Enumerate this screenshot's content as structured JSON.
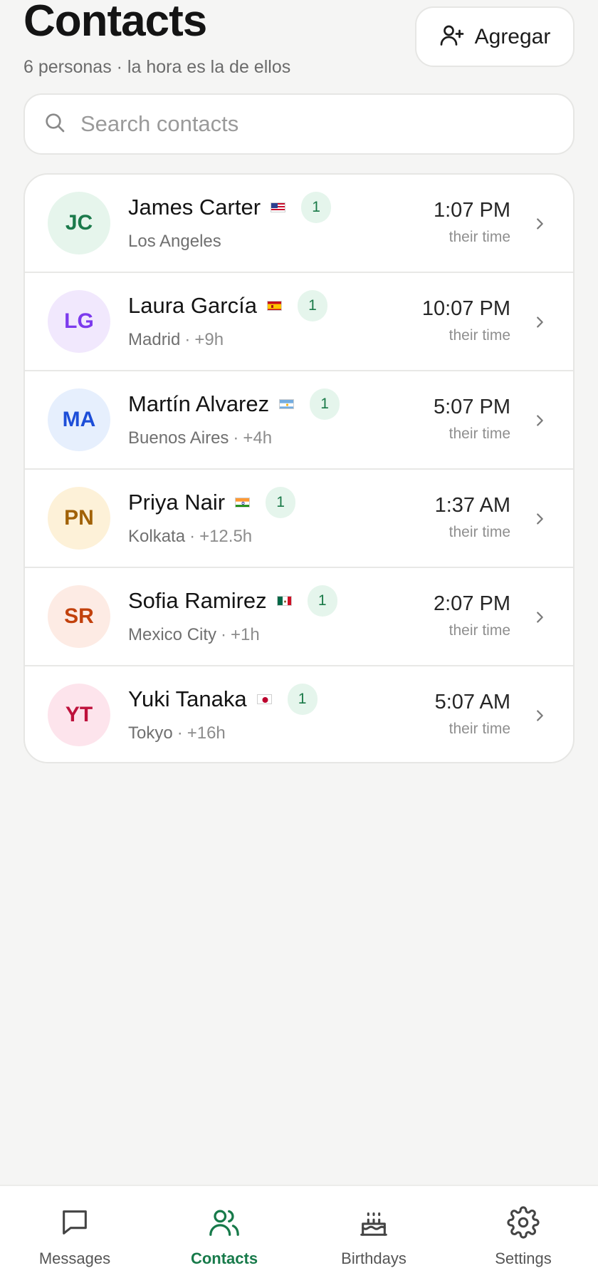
{
  "header": {
    "title": "Contacts",
    "subtitle": "6 personas · la hora es la de ellos",
    "add_label": "Agregar"
  },
  "search": {
    "placeholder": "Search contacts",
    "value": ""
  },
  "contacts": [
    {
      "initials": "JC",
      "name": "James Carter",
      "flag": "flag-us-icon",
      "badge": "1",
      "city": "Los Angeles",
      "offset": "",
      "time": "1:07 PM",
      "time_note": "their time",
      "avatar_bg": "#e6f5ec",
      "avatar_fg": "#1b7a4b"
    },
    {
      "initials": "LG",
      "name": "Laura García",
      "flag": "flag-es-icon",
      "badge": "1",
      "city": "Madrid",
      "offset": "+9h",
      "time": "10:07 PM",
      "time_note": "their time",
      "avatar_bg": "#f1e8fd",
      "avatar_fg": "#7c3aed"
    },
    {
      "initials": "MA",
      "name": "Martín Alvarez",
      "flag": "flag-ar-icon",
      "badge": "1",
      "city": "Buenos Aires",
      "offset": "+4h",
      "time": "5:07 PM",
      "time_note": "their time",
      "avatar_bg": "#e6effd",
      "avatar_fg": "#1d4ed8"
    },
    {
      "initials": "PN",
      "name": "Priya Nair",
      "flag": "flag-in-icon",
      "badge": "1",
      "city": "Kolkata",
      "offset": "+12.5h",
      "time": "1:37 AM",
      "time_note": "their time",
      "avatar_bg": "#fdf1d8",
      "avatar_fg": "#a16207"
    },
    {
      "initials": "SR",
      "name": "Sofia Ramirez",
      "flag": "flag-mx-icon",
      "badge": "1",
      "city": "Mexico City",
      "offset": "+1h",
      "time": "2:07 PM",
      "time_note": "their time",
      "avatar_bg": "#fdebe4",
      "avatar_fg": "#c2410c"
    },
    {
      "initials": "YT",
      "name": "Yuki Tanaka",
      "flag": "flag-jp-icon",
      "badge": "1",
      "city": "Tokyo",
      "offset": "+16h",
      "time": "5:07 AM",
      "time_note": "their time",
      "avatar_bg": "#fde4ec",
      "avatar_fg": "#be123c"
    }
  ],
  "tabs": [
    {
      "label": "Messages",
      "icon": "message-square-icon",
      "active": false
    },
    {
      "label": "Contacts",
      "icon": "users-icon",
      "active": true
    },
    {
      "label": "Birthdays",
      "icon": "cake-icon",
      "active": false
    },
    {
      "label": "Settings",
      "icon": "gear-icon",
      "active": false
    }
  ],
  "colors": {
    "accent": "#177a4a",
    "badge_bg": "#e5f5ec",
    "background": "#f5f5f4"
  }
}
